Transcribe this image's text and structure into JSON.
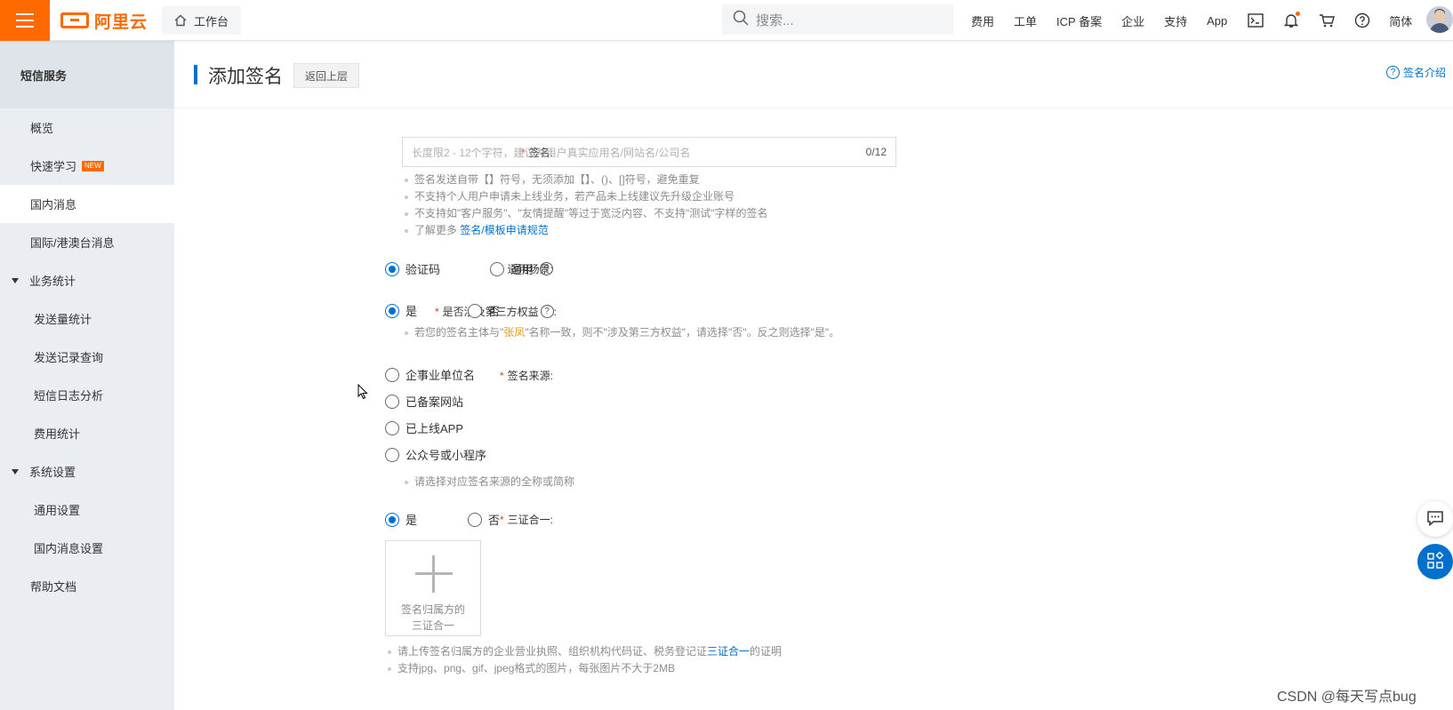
{
  "topbar": {
    "logo_text": "阿里云",
    "workbench_label": "工作台",
    "search_placeholder": "搜索...",
    "nav_items": [
      "费用",
      "工单",
      "ICP 备案",
      "企业",
      "支持",
      "App"
    ],
    "lang_label": "简体",
    "accent_color": "#ff6a00"
  },
  "sidebar": {
    "title": "短信服务",
    "items": [
      {
        "label": "概览"
      },
      {
        "label": "快速学习",
        "badge": "NEW"
      },
      {
        "label": "国内消息",
        "active": true
      },
      {
        "label": "国际/港澳台消息"
      }
    ],
    "groups": [
      {
        "label": "业务统计",
        "children": [
          "发送量统计",
          "发送记录查询",
          "短信日志分析",
          "费用统计"
        ]
      },
      {
        "label": "系统设置",
        "children": [
          "通用设置",
          "国内消息设置"
        ]
      }
    ],
    "help_label": "帮助文档"
  },
  "header": {
    "title": "添加签名",
    "back_label": "返回上层",
    "intro_label": "签名介绍"
  },
  "form": {
    "signature": {
      "label": "签名:",
      "placeholder": "长度限2 - 12个字符，建议为用户真实应用名/网站名/公司名",
      "count": "0/12",
      "tips": [
        "签名发送自带【】符号，无须添加【】、()、[]符号，避免重复",
        "不支持个人用户申请未上线业务，若产品未上线建议先升级企业账号",
        "不支持如\"客户服务\"、\"友情提醒\"等过于宽泛内容、不支持\"测试\"字样的签名"
      ],
      "learn_more_prefix": "了解更多",
      "learn_more_link": "签名/模板申请规范"
    },
    "scenario": {
      "label": "适用场景:",
      "options": [
        "验证码",
        "通用"
      ],
      "selected": "验证码"
    },
    "third_party": {
      "label": "是否涉及第三方权益",
      "options": [
        "是",
        "否"
      ],
      "selected": "是",
      "tip_prefix": "若您的签名主体与\"",
      "tip_name": "张凤",
      "tip_suffix": "\"名称一致，则不\"涉及第三方权益\"，请选择\"否\"。反之则选择\"是\"。"
    },
    "source": {
      "label": "签名来源:",
      "options": [
        "企事业单位名",
        "已备案网站",
        "已上线APP",
        "公众号或小程序"
      ],
      "tip": "请选择对应签名来源的全称或简称"
    },
    "three_in_one": {
      "label": "三证合一:",
      "options": [
        "是",
        "否"
      ],
      "selected": "是",
      "upload_text_1": "签名归属方的",
      "upload_text_2": "三证合一",
      "tip1_prefix": "请上传签名归属方的企业营业执照、组织机构代码证、税务登记证",
      "tip1_link": "三证合一",
      "tip1_suffix": "的证明",
      "tip2": "支持jpg、png、gif、jpeg格式的图片，每张图片不大于2MB"
    }
  },
  "watermark": "CSDN @每天写点bug"
}
